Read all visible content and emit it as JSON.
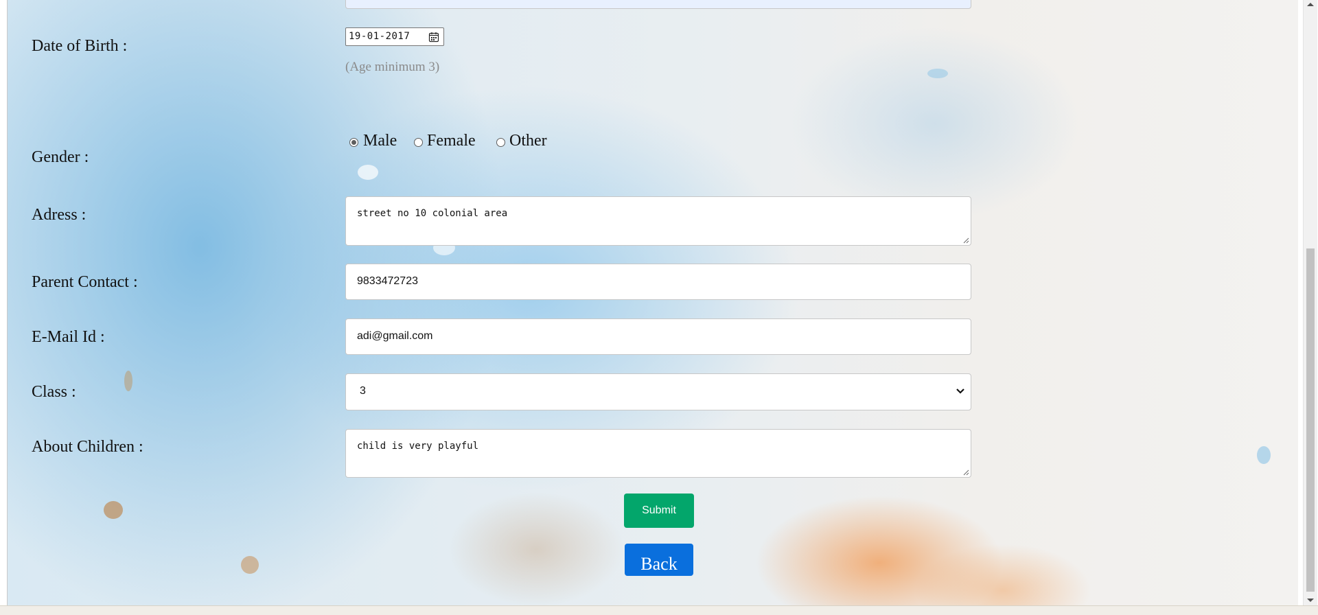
{
  "form": {
    "date_of_birth": {
      "label": "Date of Birth :",
      "value": "19-01-2017",
      "hint": "(Age minimum 3)",
      "icon": "calendar-icon"
    },
    "gender": {
      "label": "Gender :",
      "options": [
        {
          "label": "Male",
          "checked": true
        },
        {
          "label": "Female",
          "checked": false
        },
        {
          "label": "Other",
          "checked": false
        }
      ]
    },
    "address": {
      "label": "Adress :",
      "value": "street no 10 colonial area"
    },
    "parent_contact": {
      "label": "Parent Contact :",
      "value": "9833472723"
    },
    "email": {
      "label": "E-Mail Id :",
      "value": "adi@gmail.com"
    },
    "class": {
      "label": "Class :",
      "value": "3",
      "icon": "chevron-down-icon"
    },
    "about_children": {
      "label": "About Children :",
      "value": "child is very playful"
    },
    "submit_label": "Submit",
    "back_label": "Back"
  },
  "colors": {
    "submit": "#03a66b",
    "back": "#0a6fdd",
    "hint": "#8a8a8a"
  }
}
